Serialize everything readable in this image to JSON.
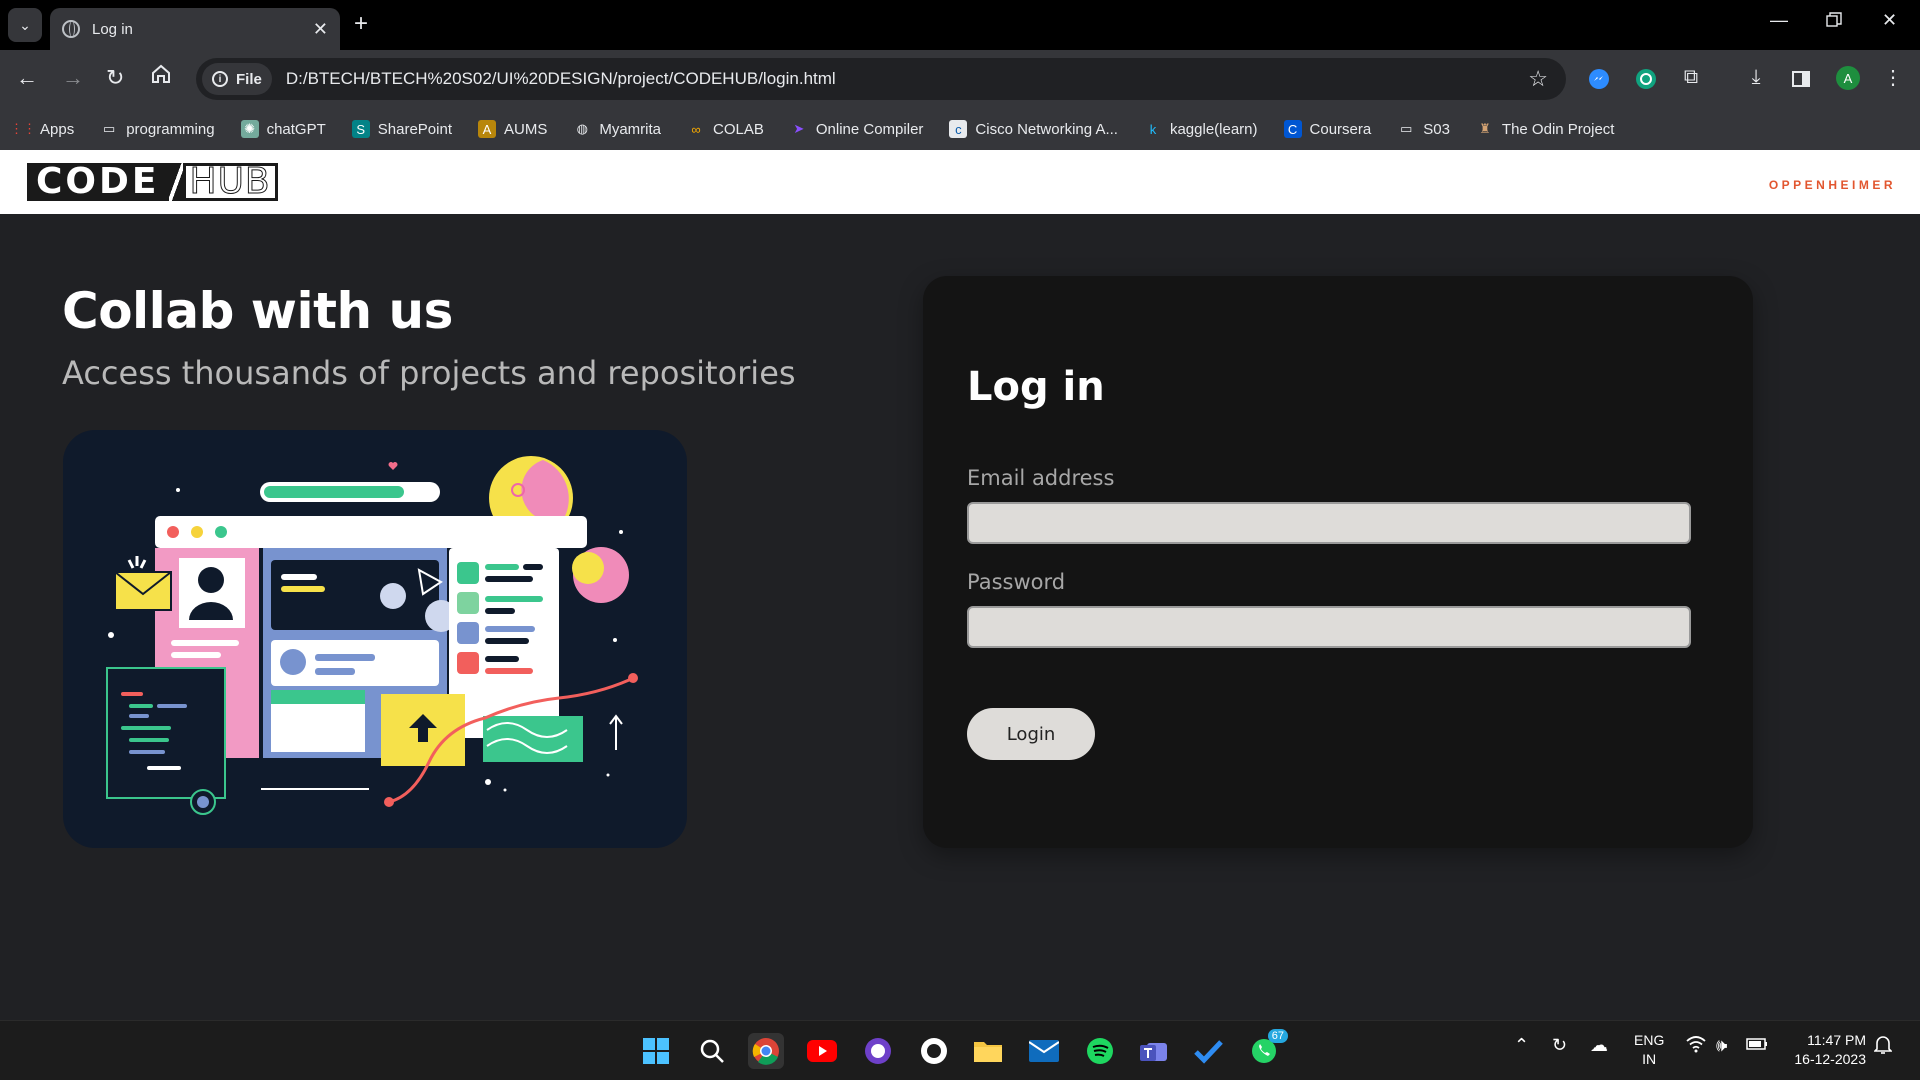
{
  "browser": {
    "tab_title": "Log in",
    "new_tab_symbol": "+",
    "file_chip": "File",
    "url": "D:/BTECH/BTECH%20S02/UI%20DESIGN/project/CODEHUB/login.html",
    "profile_initial": "A",
    "bookmarks": [
      {
        "label": "Apps",
        "icon": "apps-grid-icon"
      },
      {
        "label": "programming",
        "icon": "folder-icon"
      },
      {
        "label": "chatGPT",
        "icon": "chatgpt-icon"
      },
      {
        "label": "SharePoint",
        "icon": "sharepoint-icon"
      },
      {
        "label": "AUMS",
        "icon": "aums-icon"
      },
      {
        "label": "Myamrita",
        "icon": "globe-icon"
      },
      {
        "label": "COLAB",
        "icon": "colab-icon"
      },
      {
        "label": "Online Compiler",
        "icon": "compiler-icon"
      },
      {
        "label": "Cisco Networking A...",
        "icon": "cisco-icon"
      },
      {
        "label": "kaggle(learn)",
        "icon": "kaggle-icon"
      },
      {
        "label": "Coursera",
        "icon": "coursera-icon"
      },
      {
        "label": "S03",
        "icon": "folder-icon"
      },
      {
        "label": "The Odin Project",
        "icon": "odin-icon"
      }
    ]
  },
  "site": {
    "logo_code": "CODE",
    "logo_hub": "HUB",
    "brand_right": "OPPENHEIMER",
    "hero_title": "Collab with us",
    "hero_subtitle": "Access thousands of projects and repositories"
  },
  "login": {
    "title": "Log in",
    "email_label": "Email address",
    "email_value": "",
    "password_label": "Password",
    "password_value": "",
    "button_label": "Login"
  },
  "taskbar": {
    "whatsapp_badge": "67",
    "lang_primary": "ENG",
    "lang_secondary": "IN",
    "time": "11:47 PM",
    "date": "16-12-2023"
  },
  "colors": {
    "accent_brand": "#e2562f",
    "page_bg": "#202124",
    "card_bg": "#141414",
    "input_bg": "#dedcd9"
  }
}
